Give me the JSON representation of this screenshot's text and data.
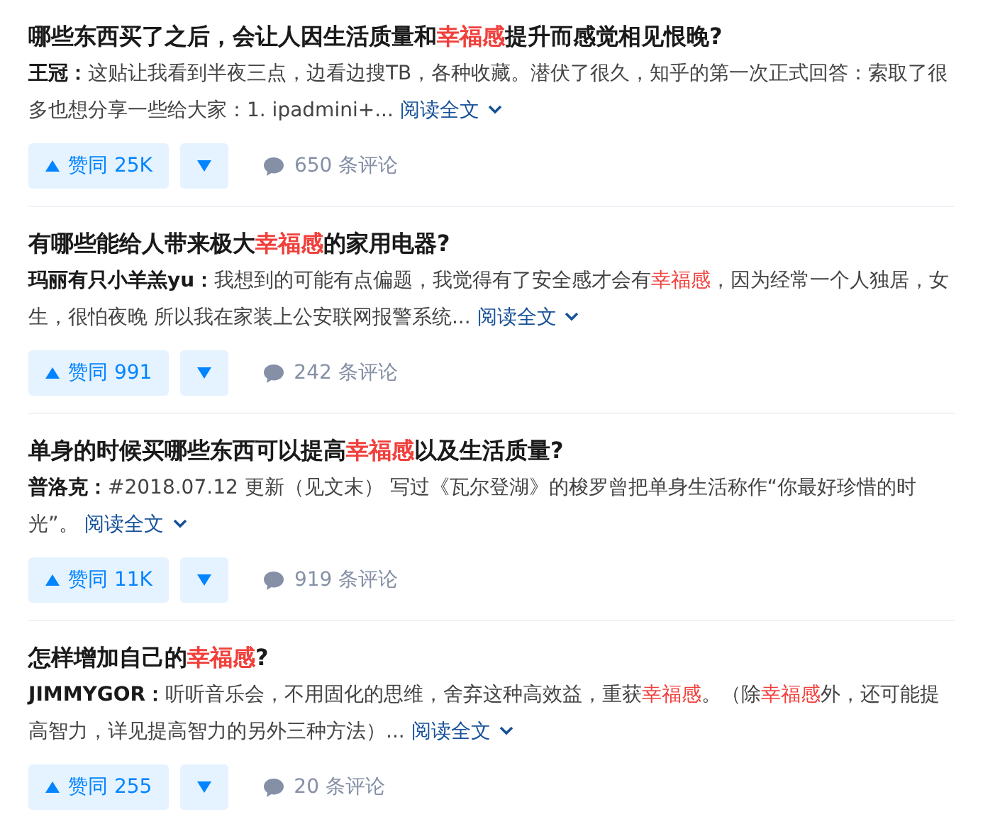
{
  "items": [
    {
      "title": [
        {
          "text": "哪些东西买了之后，会让人因生活质量和",
          "highlight": false
        },
        {
          "text": "幸福感",
          "highlight": true
        },
        {
          "text": "提升而感觉相见恨晚?",
          "highlight": false
        }
      ],
      "author": "王冠：",
      "excerpt": [
        {
          "text": "这贴让我看到半夜三点，边看边搜TB，各种收藏。潜伏了很久，知乎的第一次正式回答：索取了很多也想分享一些给大家：1. ipadmini+...",
          "highlight": false
        }
      ],
      "read_more": "阅读全文",
      "upvote": "赞同 25K",
      "comments": "650 条评论"
    },
    {
      "title": [
        {
          "text": "有哪些能给人带来极大",
          "highlight": false
        },
        {
          "text": "幸福感",
          "highlight": true
        },
        {
          "text": "的家用电器?",
          "highlight": false
        }
      ],
      "author": "玛丽有只小羊羔yu：",
      "excerpt": [
        {
          "text": "我想到的可能有点偏题，我觉得有了安全感才会有",
          "highlight": false
        },
        {
          "text": "幸福感",
          "highlight": true
        },
        {
          "text": "，因为经常一个人独居，女生，很怕夜晚 所以我在家装上公安联网报警系统...",
          "highlight": false
        }
      ],
      "read_more": "阅读全文",
      "upvote": "赞同 991",
      "comments": "242 条评论"
    },
    {
      "title": [
        {
          "text": "单身的时候买哪些东西可以提高",
          "highlight": false
        },
        {
          "text": "幸福感",
          "highlight": true
        },
        {
          "text": "以及生活质量?",
          "highlight": false
        }
      ],
      "author": "普洛克：",
      "excerpt": [
        {
          "text": "#2018.07.12 更新（见文末） 写过《瓦尔登湖》的梭罗曾把单身生活称作“你最好珍惜的时光”。",
          "highlight": false
        }
      ],
      "read_more": "阅读全文",
      "upvote": "赞同 11K",
      "comments": "919 条评论"
    },
    {
      "title": [
        {
          "text": "怎样增加自己的",
          "highlight": false
        },
        {
          "text": "幸福感",
          "highlight": true
        },
        {
          "text": "?",
          "highlight": false
        }
      ],
      "author": "JIMMYGOR：",
      "excerpt": [
        {
          "text": "听听音乐会，不用固化的思维，舍弃这种高效益，重获",
          "highlight": false
        },
        {
          "text": "幸福感",
          "highlight": true
        },
        {
          "text": "。（除",
          "highlight": false
        },
        {
          "text": "幸福感",
          "highlight": true
        },
        {
          "text": "外，还可能提高智力，详见提高智力的另外三种方法）...",
          "highlight": false
        }
      ],
      "read_more": "阅读全文",
      "upvote": "赞同 255",
      "comments": "20 条评论"
    }
  ]
}
